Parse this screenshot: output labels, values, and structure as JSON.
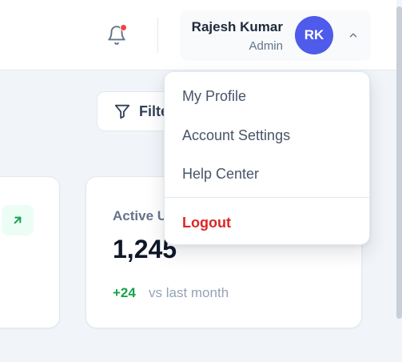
{
  "header": {
    "notification_icon": "bell-icon",
    "notification_badge_color": "#ef4444",
    "user": {
      "name": "Rajesh Kumar",
      "role": "Admin",
      "initials": "RK",
      "avatar_color": "#4f5bea"
    },
    "chevron_icon": "chevron-up-icon"
  },
  "toolbar": {
    "filter_label": "Filte",
    "filter_icon": "filter-icon"
  },
  "cards": [
    {
      "trend_icon": "arrow-up-right-icon",
      "trend_color": "#16a34a"
    },
    {
      "title": "Active U",
      "value": "1,245",
      "delta": "+24",
      "delta_label": "vs last month",
      "delta_color": "#16a34a"
    }
  ],
  "user_menu": {
    "items": [
      {
        "label": "My Profile"
      },
      {
        "label": "Account Settings"
      },
      {
        "label": "Help Center"
      }
    ],
    "logout_label": "Logout",
    "logout_color": "#dc2626"
  }
}
